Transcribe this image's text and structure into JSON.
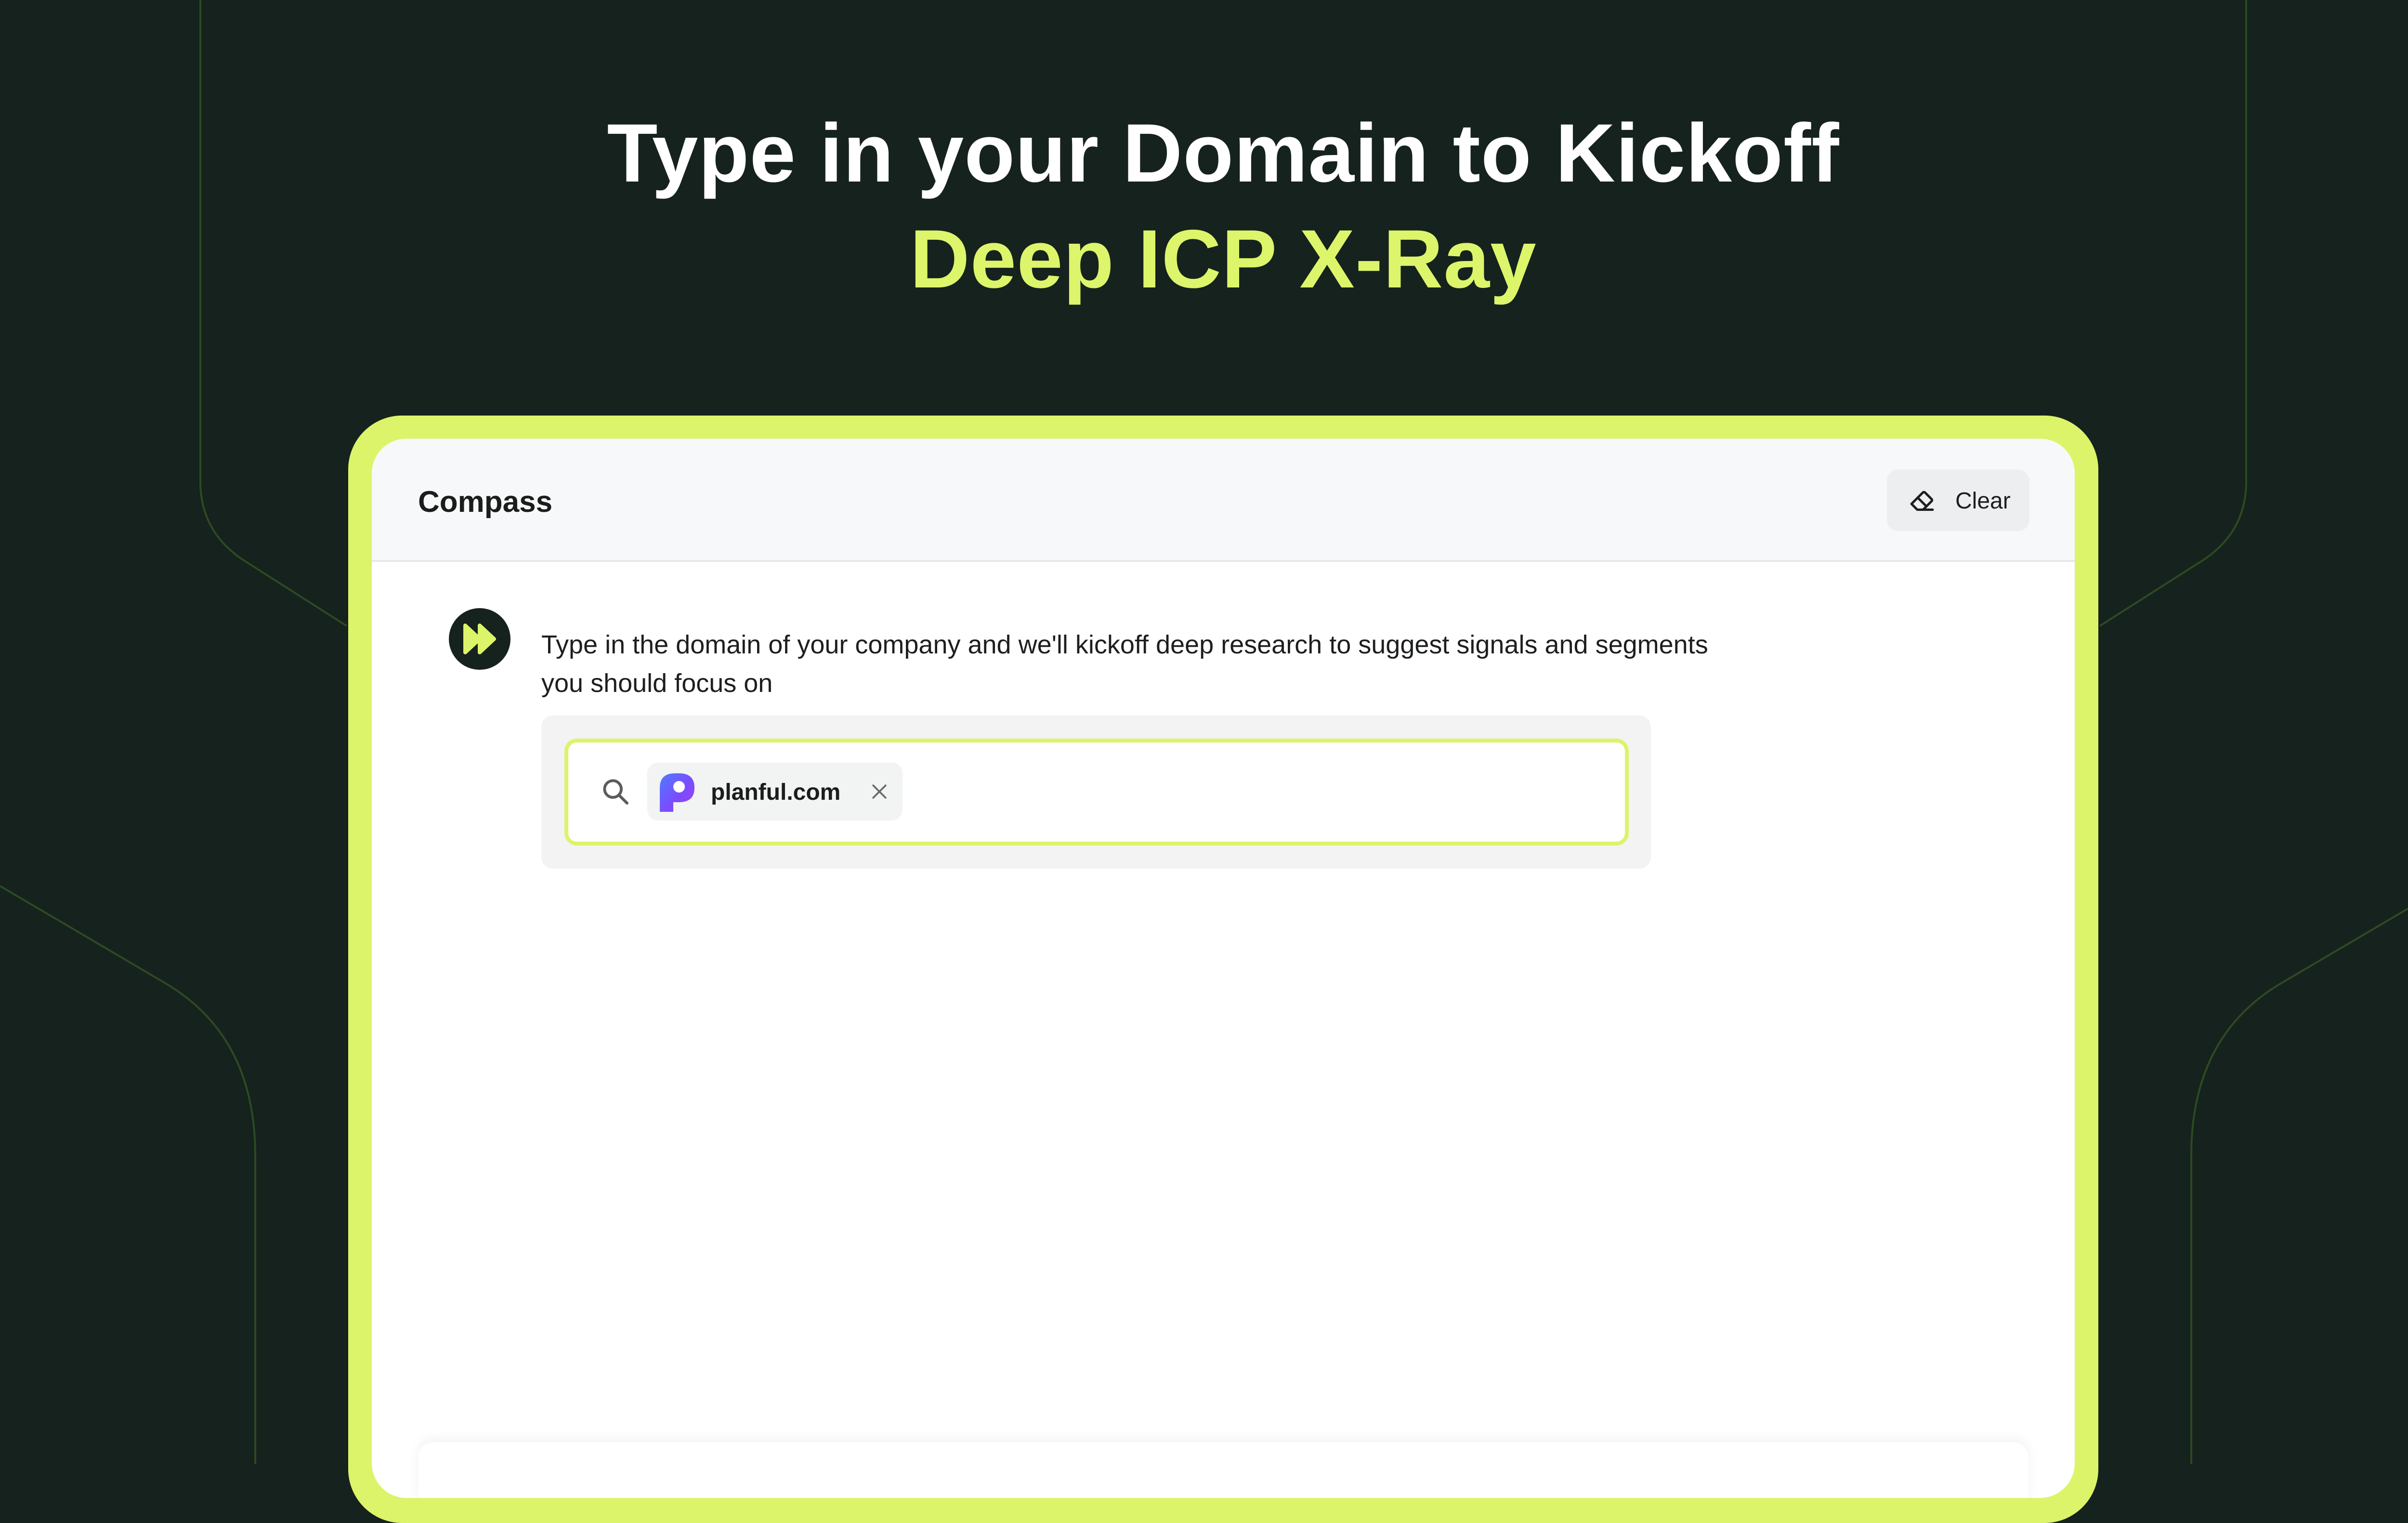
{
  "hero": {
    "line1": "Type in your Domain to Kickoff",
    "line2": "Deep ICP X-Ray"
  },
  "window": {
    "title": "Compass",
    "clear_label": "Clear"
  },
  "message": {
    "text": "Type in the domain of your company and we'll kickoff deep research to suggest signals and segments you should focus on"
  },
  "search": {
    "chip_label": "planful.com"
  },
  "icons": {
    "clear": "eraser-icon",
    "assistant": "fast-forward-icon",
    "search": "search-icon",
    "chip_logo": "planful-logo-icon",
    "chip_remove": "close-icon"
  },
  "colors": {
    "background": "#16221d",
    "accent": "#dcf46a",
    "text": "#1d1f1e"
  }
}
